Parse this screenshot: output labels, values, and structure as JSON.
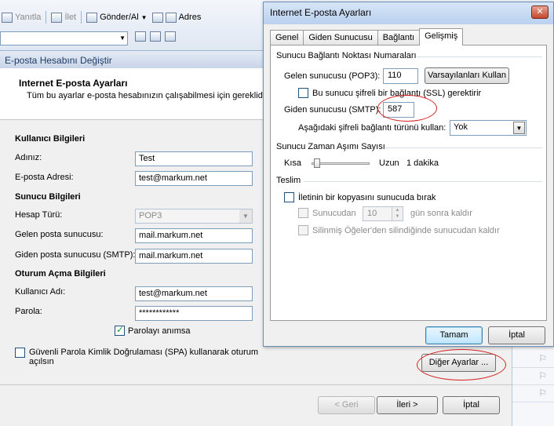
{
  "toolbar": {
    "reply_label": "Yanıtla",
    "forward_label": "İlet",
    "sendreceive_label": "Gönder/Al",
    "address_label": "Adres"
  },
  "account_dialog": {
    "title": "E-posta Hesabını Değiştir",
    "header_title": "Internet E-posta Ayarları",
    "header_desc": "Tüm bu ayarlar e-posta hesabınızın çalışabilmesi için gereklidi",
    "user_info_title": "Kullanıcı Bilgileri",
    "name_label": "Adınız:",
    "name_value": "Test",
    "email_label": "E-posta Adresi:",
    "email_value": "test@markum.net",
    "server_info_title": "Sunucu Bilgileri",
    "account_type_label": "Hesap Türü:",
    "account_type_value": "POP3",
    "incoming_label": "Gelen posta sunucusu:",
    "incoming_value": "mail.markum.net",
    "outgoing_label": "Giden posta sunucusu (SMTP):",
    "outgoing_value": "mail.markum.net",
    "logon_title": "Oturum Açma Bilgileri",
    "username_label": "Kullanıcı Adı:",
    "username_value": "test@markum.net",
    "password_label": "Parola:",
    "password_value": "************",
    "remember_label": "Parolayı anımsa",
    "spa_label_1": "Güvenli Parola Kimlik Doğrulaması (SPA) kullanarak oturum",
    "spa_label_2": "açılsın",
    "more_settings_label": "Diğer Ayarlar ...",
    "back_label": "< Geri",
    "next_label": "İleri >",
    "cancel_label": "İptal"
  },
  "settings_dialog": {
    "title": "Internet E-posta Ayarları",
    "close_glyph": "✕",
    "tabs": [
      "Genel",
      "Giden Sunucusu",
      "Bağlantı",
      "Gelişmiş"
    ],
    "ports_group": "Sunucu Bağlantı Noktası Numaraları",
    "pop3_label": "Gelen sunucusu (POP3):",
    "pop3_value": "110",
    "defaults_button": "Varsayılanları Kullan",
    "ssl_label": "Bu sunucu şifreli bir bağlantı (SSL) gerektirir",
    "smtp_label": "Giden sunucusu (SMTP):",
    "smtp_value": "587",
    "encryption_label": "Aşağıdaki şifreli bağlantı türünü kullan:",
    "encryption_value": "Yok",
    "timeout_group": "Sunucu Zaman Aşımı Sayısı",
    "short_label": "Kısa",
    "long_label": "Uzun",
    "timeout_value": "1 dakika",
    "timeout_level": 0.05,
    "delivery_group": "Teslim",
    "leave_copy_label": "İletinin bir kopyasını sunucuda bırak",
    "remove_after_label": "Sunucudan",
    "remove_after_days": "10",
    "days_after_label": "gün sonra kaldır",
    "remove_deleted_label": "Silinmiş Öğeler'den silindiğinde sunucudan kaldır",
    "ok_label": "Tamam",
    "cancel_label": "İptal"
  },
  "annotations": {
    "highlight_color": "#d42020"
  }
}
